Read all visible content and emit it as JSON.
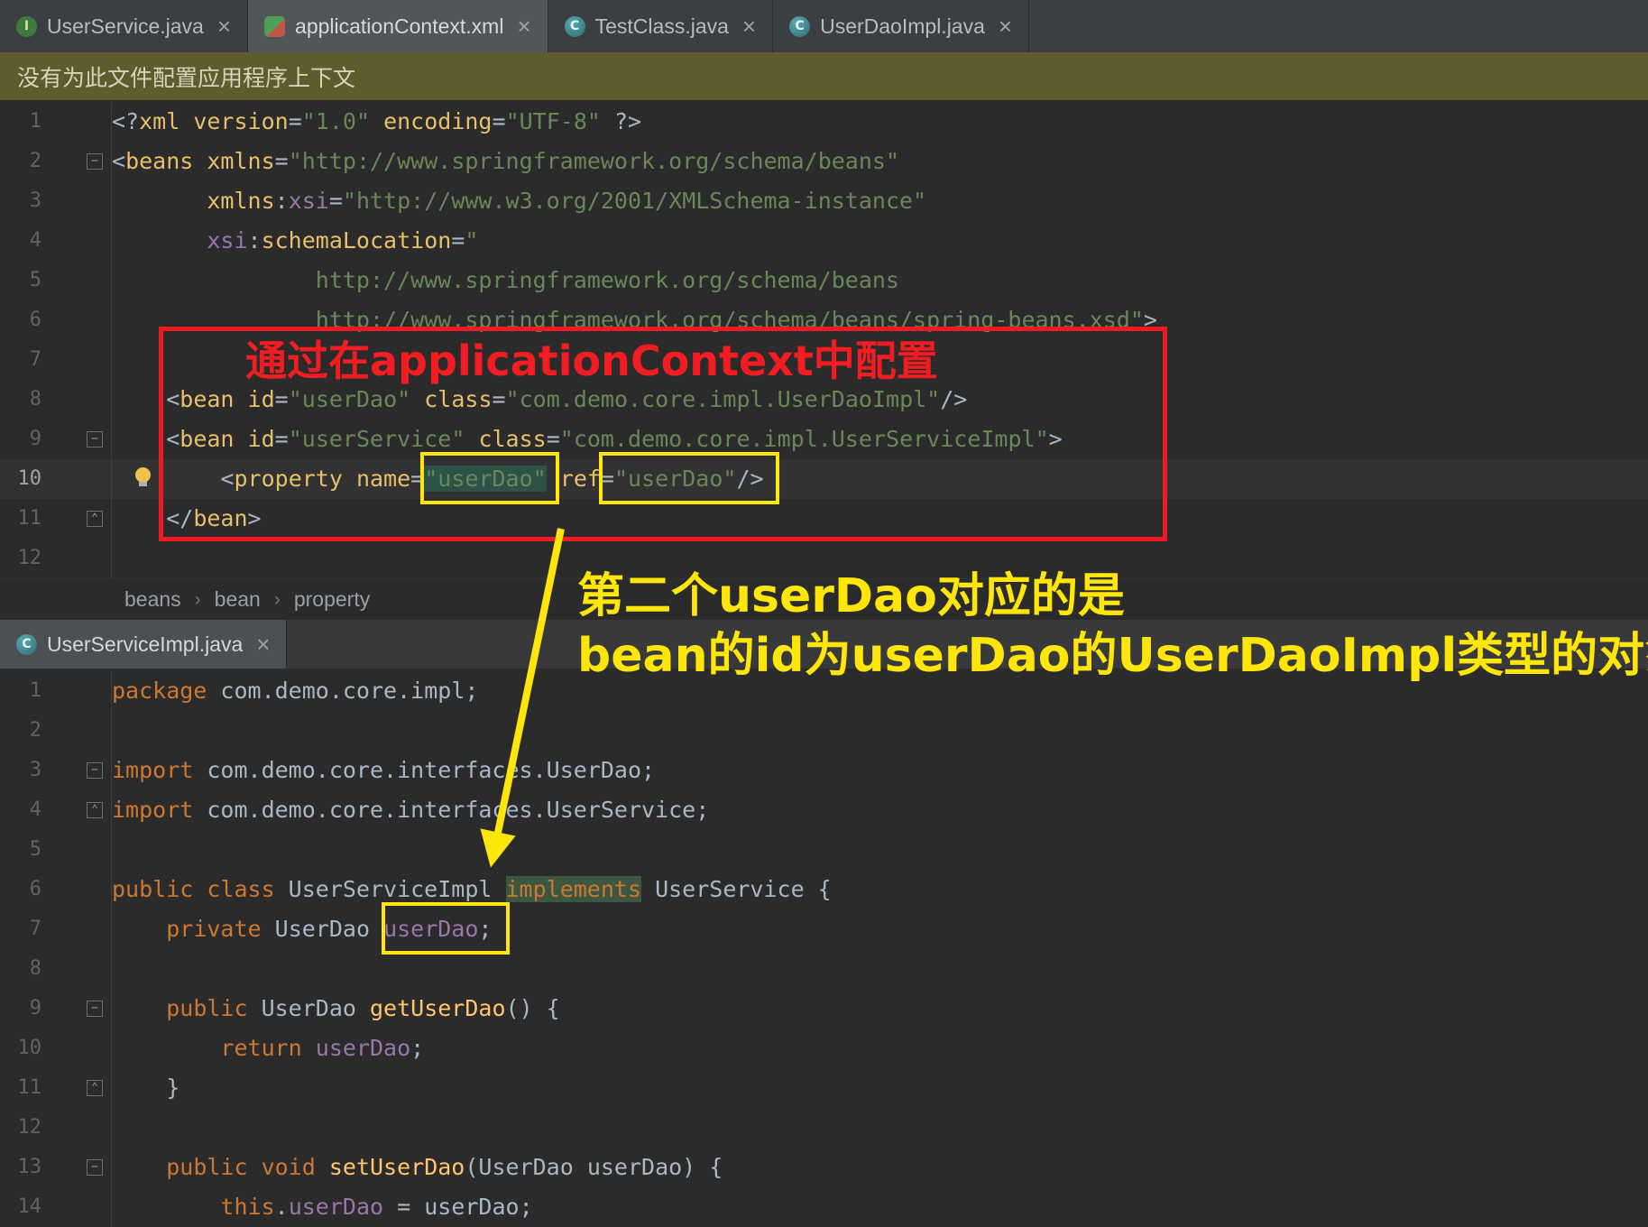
{
  "top_tabs": [
    {
      "label": "UserService.java",
      "icon": "interface-icon",
      "icon_letter": "I"
    },
    {
      "label": "applicationContext.xml",
      "icon": "spring-config-icon",
      "icon_letter": ""
    },
    {
      "label": "TestClass.java",
      "icon": "class-icon",
      "icon_letter": "C"
    },
    {
      "label": "UserDaoImpl.java",
      "icon": "class-icon",
      "icon_letter": "C"
    }
  ],
  "close_glyph": "×",
  "notification": {
    "text": "没有为此文件配置应用程序上下文"
  },
  "breadcrumbs": {
    "items": [
      "beans",
      "bean",
      "property"
    ],
    "separator": "›"
  },
  "bottom_tab": {
    "label": "UserServiceImpl.java",
    "icon": "class-icon",
    "icon_letter": "C"
  },
  "xml_editor": {
    "lines": [
      {
        "n": 1,
        "tokens": [
          {
            "t": "<?",
            "c": "punc"
          },
          {
            "t": "xml ",
            "c": "tag"
          },
          {
            "t": "version",
            "c": "attr"
          },
          {
            "t": "=",
            "c": "punc"
          },
          {
            "t": "\"1.0\"",
            "c": "str"
          },
          {
            "t": " ",
            "c": "plain"
          },
          {
            "t": "encoding",
            "c": "attr"
          },
          {
            "t": "=",
            "c": "punc"
          },
          {
            "t": "\"UTF-8\"",
            "c": "str"
          },
          {
            "t": " ?>",
            "c": "punc"
          }
        ]
      },
      {
        "n": 2,
        "fold": "start",
        "tokens": [
          {
            "t": "<",
            "c": "punc"
          },
          {
            "t": "beans ",
            "c": "tag"
          },
          {
            "t": "xmlns",
            "c": "attr"
          },
          {
            "t": "=",
            "c": "punc"
          },
          {
            "t": "\"http://www.springframework.org/schema/beans\"",
            "c": "str"
          }
        ]
      },
      {
        "n": 3,
        "tokens": [
          {
            "t": "       ",
            "c": "plain"
          },
          {
            "t": "xmlns",
            "c": "attr"
          },
          {
            "t": ":",
            "c": "punc"
          },
          {
            "t": "xsi",
            "c": "ns"
          },
          {
            "t": "=",
            "c": "punc"
          },
          {
            "t": "\"http://www.w3.org/2001/XMLSchema-instance\"",
            "c": "str"
          }
        ]
      },
      {
        "n": 4,
        "tokens": [
          {
            "t": "       ",
            "c": "plain"
          },
          {
            "t": "xsi",
            "c": "ns"
          },
          {
            "t": ":",
            "c": "punc"
          },
          {
            "t": "schemaLocation",
            "c": "attr"
          },
          {
            "t": "=",
            "c": "punc"
          },
          {
            "t": "\"",
            "c": "str"
          }
        ]
      },
      {
        "n": 5,
        "tokens": [
          {
            "t": "               ",
            "c": "plain"
          },
          {
            "t": "http://www.springframework.org/schema/beans",
            "c": "str"
          }
        ]
      },
      {
        "n": 6,
        "tokens": [
          {
            "t": "               ",
            "c": "plain"
          },
          {
            "t": "http://www.springframework.org/schema/beans/spring-beans.xsd\"",
            "c": "str"
          },
          {
            "t": ">",
            "c": "punc"
          }
        ]
      },
      {
        "n": 7,
        "tokens": []
      },
      {
        "n": 8,
        "tokens": [
          {
            "t": "    ",
            "c": "plain"
          },
          {
            "t": "<",
            "c": "punc"
          },
          {
            "t": "bean ",
            "c": "tag"
          },
          {
            "t": "id",
            "c": "attr"
          },
          {
            "t": "=",
            "c": "punc"
          },
          {
            "t": "\"userDao\"",
            "c": "str"
          },
          {
            "t": " ",
            "c": "plain"
          },
          {
            "t": "class",
            "c": "attr"
          },
          {
            "t": "=",
            "c": "punc"
          },
          {
            "t": "\"com.demo.core.impl.UserDaoImpl\"",
            "c": "str"
          },
          {
            "t": "/>",
            "c": "punc"
          }
        ]
      },
      {
        "n": 9,
        "fold": "start",
        "tokens": [
          {
            "t": "    ",
            "c": "plain"
          },
          {
            "t": "<",
            "c": "punc"
          },
          {
            "t": "bean ",
            "c": "tag"
          },
          {
            "t": "id",
            "c": "attr"
          },
          {
            "t": "=",
            "c": "punc"
          },
          {
            "t": "\"userService\"",
            "c": "str"
          },
          {
            "t": " ",
            "c": "plain"
          },
          {
            "t": "class",
            "c": "attr"
          },
          {
            "t": "=",
            "c": "punc"
          },
          {
            "t": "\"com.demo.core.impl.UserServiceImpl\"",
            "c": "str"
          },
          {
            "t": ">",
            "c": "punc"
          }
        ]
      },
      {
        "n": 10,
        "current": true,
        "bulb": true,
        "tokens": [
          {
            "t": "        ",
            "c": "plain"
          },
          {
            "t": "<",
            "c": "punc"
          },
          {
            "t": "property ",
            "c": "tag"
          },
          {
            "t": "name",
            "c": "attr"
          },
          {
            "t": "=",
            "c": "punc"
          },
          {
            "t": "\"userDao\"",
            "c": "str",
            "hl": "sel"
          },
          {
            "t": " ",
            "c": "plain"
          },
          {
            "t": "ref",
            "c": "attr"
          },
          {
            "t": "=",
            "c": "punc"
          },
          {
            "t": "\"userDao\"",
            "c": "str"
          },
          {
            "t": "/>",
            "c": "punc"
          }
        ]
      },
      {
        "n": 11,
        "fold": "end",
        "tokens": [
          {
            "t": "    ",
            "c": "plain"
          },
          {
            "t": "</",
            "c": "punc"
          },
          {
            "t": "bean",
            "c": "tag"
          },
          {
            "t": ">",
            "c": "punc"
          }
        ]
      },
      {
        "n": 12,
        "tokens": []
      }
    ]
  },
  "java_editor": {
    "lines": [
      {
        "n": 1,
        "tokens": [
          {
            "t": "package ",
            "c": "kw"
          },
          {
            "t": "com.demo.core.impl;",
            "c": "plain"
          }
        ]
      },
      {
        "n": 2,
        "tokens": []
      },
      {
        "n": 3,
        "fold": "start",
        "tokens": [
          {
            "t": "import ",
            "c": "kw"
          },
          {
            "t": "com.demo.core.interfaces.UserDao;",
            "c": "plain"
          }
        ]
      },
      {
        "n": 4,
        "fold": "end",
        "tokens": [
          {
            "t": "import ",
            "c": "kw"
          },
          {
            "t": "com.demo.core.interfaces.UserService;",
            "c": "plain"
          }
        ]
      },
      {
        "n": 5,
        "tokens": []
      },
      {
        "n": 6,
        "tokens": [
          {
            "t": "public class ",
            "c": "kw"
          },
          {
            "t": "UserServiceImpl ",
            "c": "plain"
          },
          {
            "t": "implements",
            "c": "kw",
            "hl": "impl"
          },
          {
            "t": " UserService {",
            "c": "plain"
          }
        ]
      },
      {
        "n": 7,
        "tokens": [
          {
            "t": "    ",
            "c": "plain"
          },
          {
            "t": "private ",
            "c": "kw"
          },
          {
            "t": "UserDao ",
            "c": "plain"
          },
          {
            "t": "userDao",
            "c": "field"
          },
          {
            "t": ";",
            "c": "plain"
          }
        ]
      },
      {
        "n": 8,
        "tokens": []
      },
      {
        "n": 9,
        "fold": "start",
        "tokens": [
          {
            "t": "    ",
            "c": "plain"
          },
          {
            "t": "public ",
            "c": "kw"
          },
          {
            "t": "UserDao ",
            "c": "plain"
          },
          {
            "t": "getUserDao",
            "c": "method"
          },
          {
            "t": "() {",
            "c": "plain"
          }
        ]
      },
      {
        "n": 10,
        "tokens": [
          {
            "t": "        ",
            "c": "plain"
          },
          {
            "t": "return ",
            "c": "kw"
          },
          {
            "t": "userDao",
            "c": "field"
          },
          {
            "t": ";",
            "c": "plain"
          }
        ]
      },
      {
        "n": 11,
        "fold": "end",
        "tokens": [
          {
            "t": "    }",
            "c": "plain"
          }
        ]
      },
      {
        "n": 12,
        "tokens": []
      },
      {
        "n": 13,
        "fold": "start",
        "tokens": [
          {
            "t": "    ",
            "c": "plain"
          },
          {
            "t": "public void ",
            "c": "kw"
          },
          {
            "t": "setUserDao",
            "c": "method"
          },
          {
            "t": "(UserDao userDao) {",
            "c": "plain"
          }
        ]
      },
      {
        "n": 14,
        "tokens": [
          {
            "t": "        ",
            "c": "plain"
          },
          {
            "t": "this",
            "c": "kw"
          },
          {
            "t": ".",
            "c": "plain"
          },
          {
            "t": "userDao",
            "c": "field"
          },
          {
            "t": " = userDao;",
            "c": "plain"
          }
        ]
      }
    ]
  },
  "annotations": {
    "red_caption": "通过在applicationContext中配置",
    "yellow_caption_line1": "第二个userDao对应的是",
    "yellow_caption_line2": "bean的id为userDao的UserDaoImpl类型的对象",
    "colors": {
      "red": "#ee1b24",
      "yellow": "#ffe60a"
    }
  }
}
